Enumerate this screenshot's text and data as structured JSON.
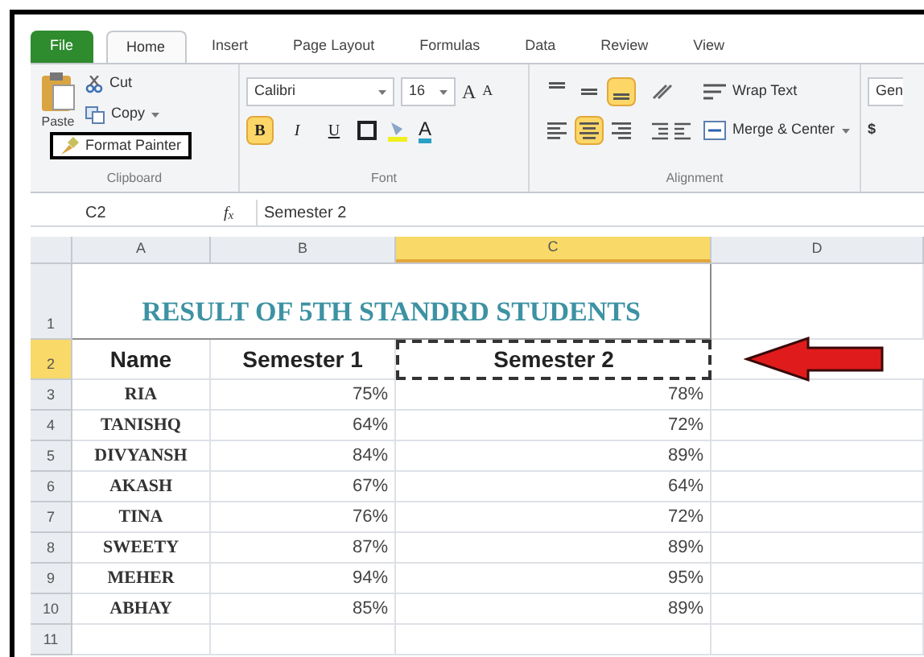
{
  "tabs": [
    {
      "label": "File",
      "kind": "file",
      "selected": false
    },
    {
      "label": "Home",
      "kind": "tab",
      "selected": true
    },
    {
      "label": "Insert",
      "kind": "tab",
      "selected": false
    },
    {
      "label": "Page Layout",
      "kind": "tab",
      "selected": false
    },
    {
      "label": "Formulas",
      "kind": "tab",
      "selected": false
    },
    {
      "label": "Data",
      "kind": "tab",
      "selected": false
    },
    {
      "label": "Review",
      "kind": "tab",
      "selected": false
    },
    {
      "label": "View",
      "kind": "tab",
      "selected": false
    }
  ],
  "clipboard": {
    "paste": "Paste",
    "cut": "Cut",
    "copy": "Copy",
    "format_painter": "Format Painter",
    "format_painter_highlighted": true,
    "label": "Clipboard"
  },
  "font": {
    "name": "Calibri",
    "size": "16",
    "grow": "A",
    "shrink": "A",
    "styles": [
      {
        "label": "B",
        "kind": "bold",
        "selected": true
      },
      {
        "label": "I",
        "kind": "italic",
        "selected": false
      },
      {
        "label": "U",
        "kind": "underline",
        "selected": false
      }
    ],
    "font_color": "A",
    "label": "Font"
  },
  "alignment": {
    "vertical": [
      {
        "kind": "top",
        "selected": false
      },
      {
        "kind": "middle",
        "selected": false
      },
      {
        "kind": "bottom",
        "selected": true
      }
    ],
    "horizontal": [
      {
        "kind": "left",
        "selected": false
      },
      {
        "kind": "center",
        "selected": true
      },
      {
        "kind": "right",
        "selected": false
      }
    ],
    "wrap_text": "Wrap Text",
    "merge_center": "Merge & Center",
    "label": "Alignment"
  },
  "number": {
    "format": "Gen",
    "currency": "$"
  },
  "formula_bar": {
    "name_box": "C2",
    "fx": "f$_{x}$",
    "value": "Semester 2"
  },
  "columns": [
    {
      "label": "A",
      "selected": false
    },
    {
      "label": "B",
      "selected": false
    },
    {
      "label": "C",
      "selected": true
    },
    {
      "label": "D",
      "selected": false
    }
  ],
  "row_numbers": [
    {
      "label": "1",
      "selected": false
    },
    {
      "label": "2",
      "selected": true
    },
    {
      "label": "3",
      "selected": false
    },
    {
      "label": "4",
      "selected": false
    },
    {
      "label": "5",
      "selected": false
    },
    {
      "label": "6",
      "selected": false
    },
    {
      "label": "7",
      "selected": false
    },
    {
      "label": "8",
      "selected": false
    },
    {
      "label": "9",
      "selected": false
    },
    {
      "label": "10",
      "selected": false
    },
    {
      "label": "11",
      "selected": false
    }
  ],
  "title": "RESULT OF 5TH STANDRD STUDENTS",
  "header": [
    {
      "text": "Name",
      "copied": false
    },
    {
      "text": "Semester 1",
      "copied": false
    },
    {
      "text": "Semester 2",
      "copied": true
    }
  ],
  "students": [
    {
      "name": "RIA",
      "semester_1": "75%",
      "semester_2": "78%"
    },
    {
      "name": "TANISHQ",
      "semester_1": "64%",
      "semester_2": "72%"
    },
    {
      "name": "DIVYANSH",
      "semester_1": "84%",
      "semester_2": "89%"
    },
    {
      "name": "AKASH",
      "semester_1": "67%",
      "semester_2": "64%"
    },
    {
      "name": "TINA",
      "semester_1": "76%",
      "semester_2": "72%"
    },
    {
      "name": "SWEETY",
      "semester_1": "87%",
      "semester_2": "89%"
    },
    {
      "name": "MEHER",
      "semester_1": "94%",
      "semester_2": "95%"
    },
    {
      "name": "ABHAY",
      "semester_1": "85%",
      "semester_2": "89%"
    }
  ]
}
